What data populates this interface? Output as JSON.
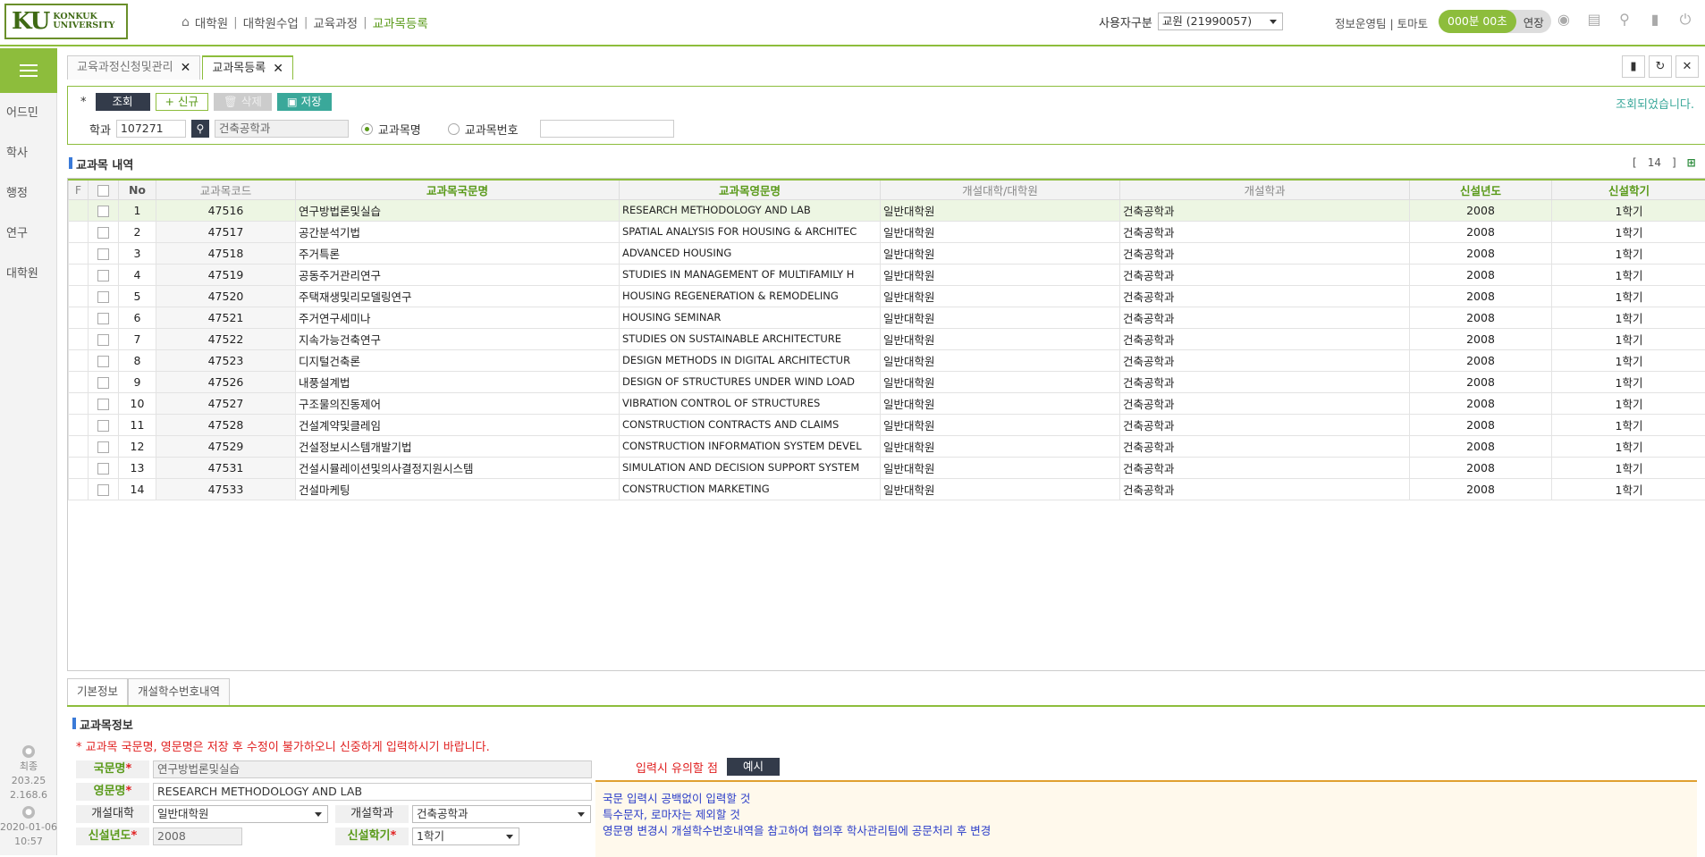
{
  "header": {
    "logo_ku": "KU",
    "logo_line1": "KONKUK",
    "logo_line2": "UNIVERSITY",
    "crumbs": [
      "대학원",
      "대학원수업",
      "교육과정",
      "교과목등록"
    ],
    "user_type_label": "사용자구분",
    "user_type_value": "교원 (21990057)",
    "team": "정보운영팀 | 토마토",
    "timer": "000분 00초",
    "extend": "연장"
  },
  "leftnav": {
    "items": [
      "어드민",
      "학사",
      "행정",
      "연구",
      "대학원"
    ],
    "info_label": "최종",
    "ip": "203.252.168.6",
    "date": "2020-01-06",
    "time": "10:57"
  },
  "tabs": [
    {
      "label": "교육과정신청및관리"
    },
    {
      "label": "교과목등록"
    }
  ],
  "toolbar": {
    "star": "*",
    "query": "조회",
    "new": "신규",
    "delete": "삭제",
    "save": "저장",
    "status": "조회되었습니다."
  },
  "filter": {
    "dept_label": "학과",
    "dept_code": "107271",
    "dept_name": "건축공학과",
    "radio_name": "교과목명",
    "radio_number": "교과목번호",
    "search_value": ""
  },
  "list": {
    "title": "교과목 내역",
    "count": "14",
    "columns": [
      "F",
      "",
      "No",
      "교과목코드",
      "교과목국문명",
      "교과목영문명",
      "개설대학/대학원",
      "개설학과",
      "신설년도",
      "신설학기"
    ],
    "rows": [
      [
        "1",
        "47516",
        "연구방법론및실습",
        "RESEARCH METHODOLOGY AND LAB",
        "일반대학원",
        "건축공학과",
        "2008",
        "1학기"
      ],
      [
        "2",
        "47517",
        "공간분석기법",
        "SPATIAL ANALYSIS FOR HOUSING & ARCHITEC",
        "일반대학원",
        "건축공학과",
        "2008",
        "1학기"
      ],
      [
        "3",
        "47518",
        "주거특론",
        "ADVANCED HOUSING",
        "일반대학원",
        "건축공학과",
        "2008",
        "1학기"
      ],
      [
        "4",
        "47519",
        "공동주거관리연구",
        "STUDIES IN MANAGEMENT OF MULTIFAMILY H",
        "일반대학원",
        "건축공학과",
        "2008",
        "1학기"
      ],
      [
        "5",
        "47520",
        "주택재생및리모델링연구",
        "HOUSING REGENERATION & REMODELING",
        "일반대학원",
        "건축공학과",
        "2008",
        "1학기"
      ],
      [
        "6",
        "47521",
        "주거연구세미나",
        "HOUSING SEMINAR",
        "일반대학원",
        "건축공학과",
        "2008",
        "1학기"
      ],
      [
        "7",
        "47522",
        "지속가능건축연구",
        "STUDIES ON SUSTAINABLE ARCHITECTURE",
        "일반대학원",
        "건축공학과",
        "2008",
        "1학기"
      ],
      [
        "8",
        "47523",
        "디지털건축론",
        "DESIGN METHODS IN DIGITAL ARCHITECTUR",
        "일반대학원",
        "건축공학과",
        "2008",
        "1학기"
      ],
      [
        "9",
        "47526",
        "내풍설계법",
        "DESIGN OF STRUCTURES UNDER WIND LOAD",
        "일반대학원",
        "건축공학과",
        "2008",
        "1학기"
      ],
      [
        "10",
        "47527",
        "구조물의진동제어",
        "VIBRATION CONTROL OF STRUCTURES",
        "일반대학원",
        "건축공학과",
        "2008",
        "1학기"
      ],
      [
        "11",
        "47528",
        "건설계약및클레임",
        "CONSTRUCTION CONTRACTS AND CLAIMS",
        "일반대학원",
        "건축공학과",
        "2008",
        "1학기"
      ],
      [
        "12",
        "47529",
        "건설정보시스템개발기법",
        "CONSTRUCTION INFORMATION SYSTEM DEVEL",
        "일반대학원",
        "건축공학과",
        "2008",
        "1학기"
      ],
      [
        "13",
        "47531",
        "건설시뮬레이션및의사결정지원시스템",
        "SIMULATION AND DECISION SUPPORT SYSTEM",
        "일반대학원",
        "건축공학과",
        "2008",
        "1학기"
      ],
      [
        "14",
        "47533",
        "건설마케팅",
        "CONSTRUCTION MARKETING",
        "일반대학원",
        "건축공학과",
        "2008",
        "1학기"
      ]
    ]
  },
  "detail_tabs": [
    "기본정보",
    "개설학수번호내역"
  ],
  "detail": {
    "title": "교과목정보",
    "warning": "* 교과목 국문명, 영문명은 저장 후 수정이 불가하오니 신중하게 입력하시기 바랍니다.",
    "kor_label": "국문명",
    "kor_value": "연구방법론및실습",
    "eng_label": "영문명",
    "eng_value": "RESEARCH METHODOLOGY AND LAB",
    "college_label": "개설대학",
    "college_value": "일반대학원",
    "dept_label": "개설학과",
    "dept_value": "건축공학과",
    "year_label": "신설년도",
    "year_value": "2008",
    "term_label": "신설학기",
    "term_value": "1학기",
    "notes_label": "입력시 유의할 점",
    "example_btn": "예시",
    "notes": [
      "국문 입력시 공백없이 입력할 것",
      "특수문자, 로마자는 제외할 것",
      "영문명 변경시 개설학수번호내역을 참고하여 협의후 학사관리팀에 공문처리 후 변경"
    ]
  },
  "colors": {
    "accent": "#8dbd3c",
    "dark": "#333b4a",
    "teal": "#3aa89a",
    "warn": "#e02020"
  }
}
